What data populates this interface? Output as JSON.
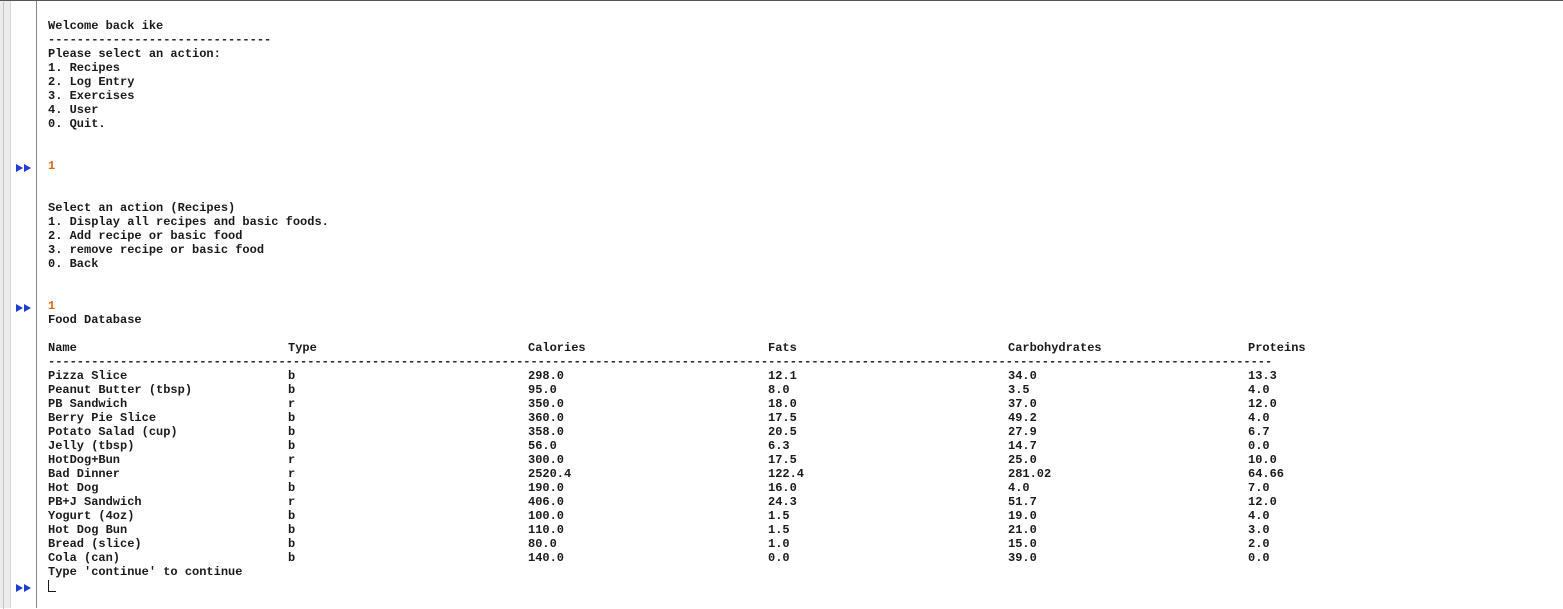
{
  "menu": {
    "welcome": "Welcome back ike",
    "separator": "-------------------------------",
    "prompt": "Please select an action:",
    "options": [
      "1. Recipes",
      "2. Log Entry",
      "3. Exercises",
      "4. User",
      "0. Quit."
    ]
  },
  "inputs": {
    "first": "1",
    "second": "1",
    "current": ""
  },
  "recipes_menu": {
    "prompt": "Select an action (Recipes)",
    "options": [
      "1. Display all recipes and basic foods.",
      "2. Add recipe or basic food",
      "3. remove recipe or basic food",
      "0. Back"
    ]
  },
  "food_table": {
    "title": "Food Database",
    "headers": [
      "Name",
      "Type",
      "Calories",
      "Fats",
      "Carbohydrates",
      "Proteins"
    ],
    "rule": "--------------------------------------------------------------------------------------------------------------------------------------------------------------------------",
    "rows": [
      [
        "Pizza Slice",
        "b",
        "298.0",
        "12.1",
        "34.0",
        "13.3"
      ],
      [
        "Peanut Butter (tbsp)",
        "b",
        "95.0",
        "8.0",
        "3.5",
        "4.0"
      ],
      [
        "PB Sandwich",
        "r",
        "350.0",
        "18.0",
        "37.0",
        "12.0"
      ],
      [
        "Berry Pie Slice",
        "b",
        "360.0",
        "17.5",
        "49.2",
        "4.0"
      ],
      [
        "Potato Salad (cup)",
        "b",
        "358.0",
        "20.5",
        "27.9",
        "6.7"
      ],
      [
        "Jelly (tbsp)",
        "b",
        "56.0",
        "6.3",
        "14.7",
        "0.0"
      ],
      [
        "HotDog+Bun",
        "r",
        "300.0",
        "17.5",
        "25.0",
        "10.0"
      ],
      [
        "Bad Dinner",
        "r",
        "2520.4",
        "122.4",
        "281.02",
        "64.66"
      ],
      [
        "Hot Dog",
        "b",
        "190.0",
        "16.0",
        "4.0",
        "7.0"
      ],
      [
        "PB+J Sandwich",
        "r",
        "406.0",
        "24.3",
        "51.7",
        "12.0"
      ],
      [
        "Yogurt (4oz)",
        "b",
        "100.0",
        "1.5",
        "19.0",
        "4.0"
      ],
      [
        "Hot Dog Bun",
        "b",
        "110.0",
        "1.5",
        "21.0",
        "3.0"
      ],
      [
        "Bread (slice)",
        "b",
        "80.0",
        "1.0",
        "15.0",
        "2.0"
      ],
      [
        "Cola (can)",
        "b",
        "140.0",
        "0.0",
        "39.0",
        "0.0"
      ]
    ],
    "footer": "Type 'continue' to continue"
  },
  "icons": {
    "prompt_marker": "double-right-triangle-icon",
    "prompt_color": "#1f3fd0",
    "input_color": "#e06a10"
  }
}
